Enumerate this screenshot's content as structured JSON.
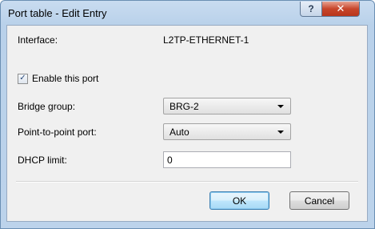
{
  "window": {
    "title": "Port table - Edit Entry",
    "help_glyph": "?",
    "close_glyph": "✕"
  },
  "form": {
    "interface_label": "Interface:",
    "interface_value": "L2TP-ETHERNET-1",
    "enable_port_label": "Enable this port",
    "enable_port_checked": true,
    "check_glyph": "✓",
    "bridge_group_label": "Bridge group:",
    "bridge_group_value": "BRG-2",
    "p2p_port_label": "Point-to-point port:",
    "p2p_port_value": "Auto",
    "dhcp_limit_label": "DHCP limit:",
    "dhcp_limit_value": "0"
  },
  "buttons": {
    "ok_label": "OK",
    "cancel_label": "Cancel"
  }
}
